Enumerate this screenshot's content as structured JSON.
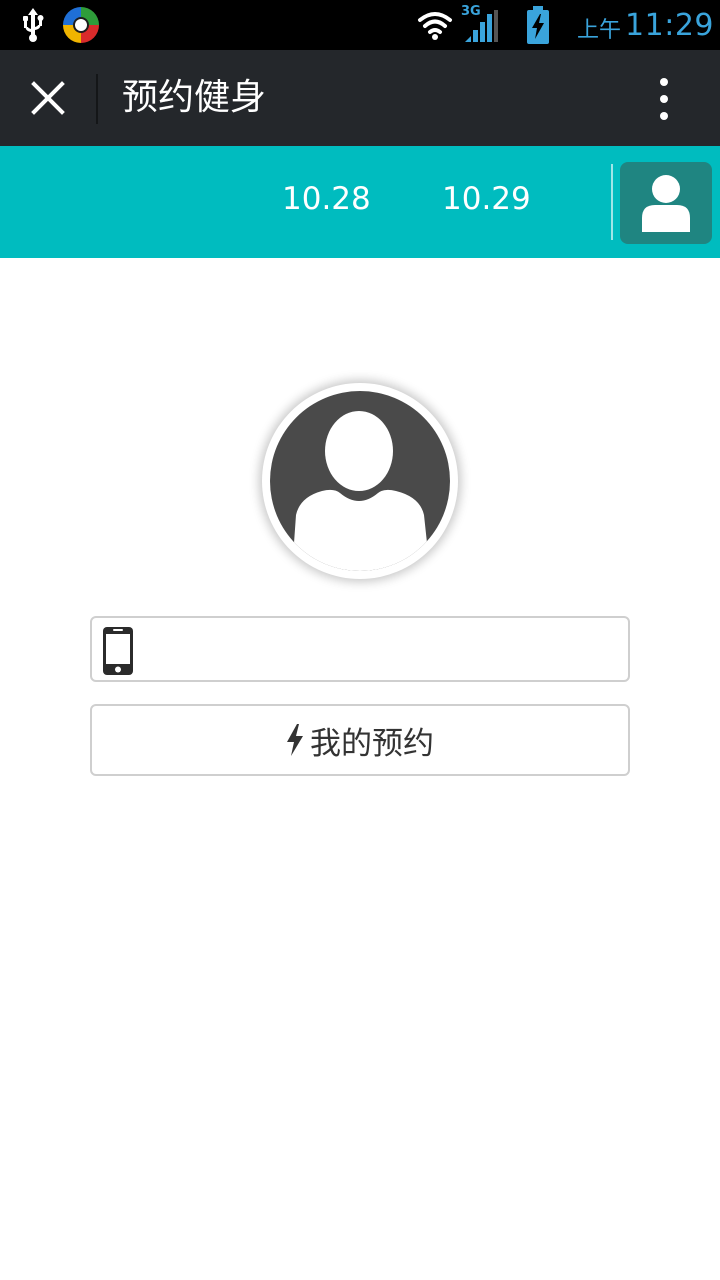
{
  "status_bar": {
    "ampm": "上午",
    "time": "11:29",
    "network_label": "3G",
    "icons": [
      "usb-icon",
      "app-logo-icon",
      "wifi-icon",
      "signal-icon",
      "battery-charging-icon"
    ]
  },
  "title_bar": {
    "title": "预约健身",
    "close_icon": "close-icon",
    "more_icon": "more-vertical-icon"
  },
  "date_bar": {
    "tabs": [
      {
        "label": "10.28"
      },
      {
        "label": "10.29"
      }
    ],
    "profile_icon": "user-icon"
  },
  "main": {
    "avatar_icon": "default-avatar",
    "phone_field": {
      "value": "",
      "placeholder": "",
      "icon": "mobile-phone-icon"
    },
    "my_reservation_button": {
      "label": "我的预约",
      "icon": "bolt-icon"
    }
  },
  "colors": {
    "status_bar_bg": "#000000",
    "title_bar_bg": "#24272b",
    "accent_teal": "#00bcbf",
    "profile_button_bg": "#1f8581",
    "status_text": "#3aa4dc",
    "avatar_gray": "#4a4a4a"
  }
}
